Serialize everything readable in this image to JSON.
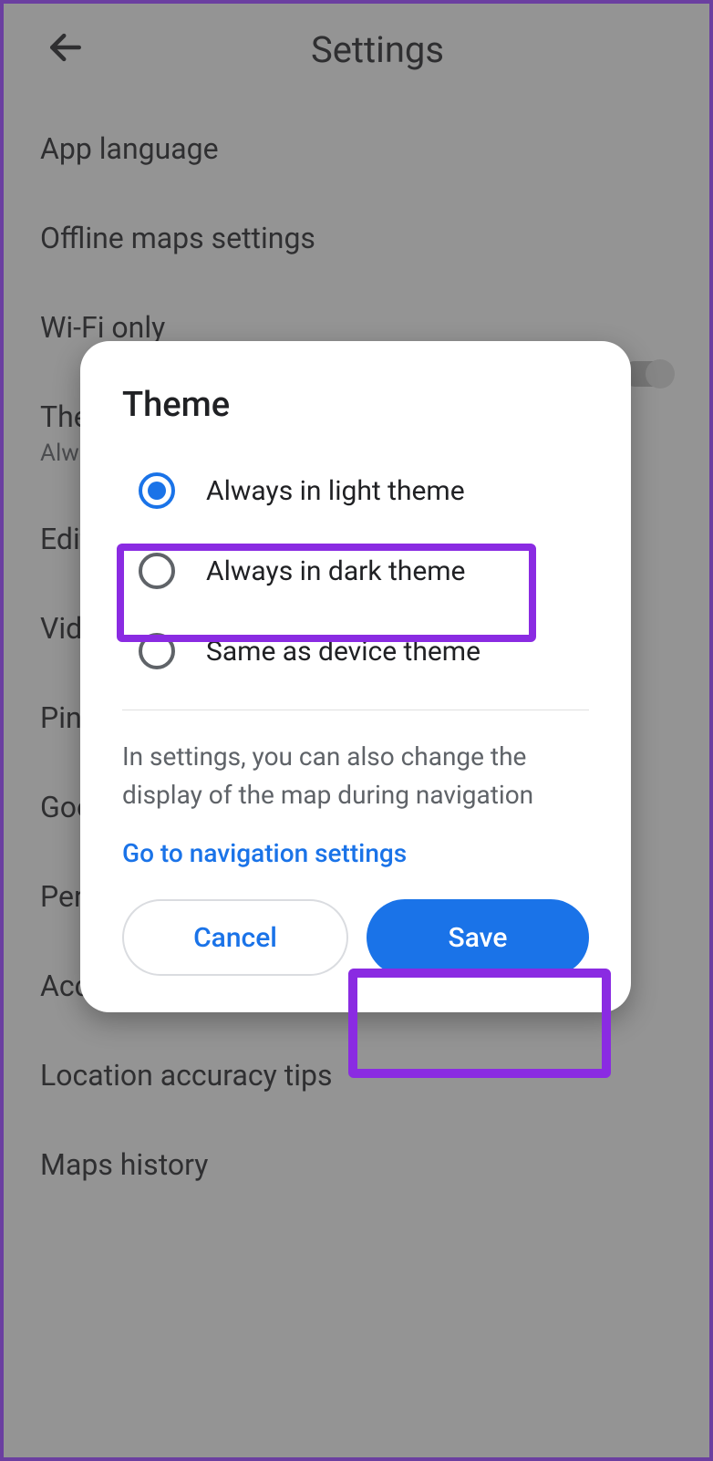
{
  "header": {
    "title": "Settings"
  },
  "settings": {
    "items": [
      {
        "label": "App language"
      },
      {
        "label": "Offline maps settings"
      },
      {
        "label": "Wi-Fi only"
      },
      {
        "label": "Theme",
        "sub": "Always in light theme"
      },
      {
        "label": "Edit home or work"
      },
      {
        "label": "Video settings"
      },
      {
        "label": "Pinned trips"
      },
      {
        "label": "Google Assistant settings"
      },
      {
        "label": "Personal content"
      },
      {
        "label": "Accessibility settings"
      },
      {
        "label": "Location accuracy tips"
      },
      {
        "label": "Maps history"
      }
    ]
  },
  "dialog": {
    "title": "Theme",
    "options": [
      {
        "label": "Always in light theme",
        "selected": true
      },
      {
        "label": "Always in dark theme",
        "selected": false
      },
      {
        "label": "Same as device theme",
        "selected": false
      }
    ],
    "note": "In settings, you can also change the display of the map during navigation",
    "link": "Go to navigation settings",
    "cancel": "Cancel",
    "save": "Save"
  }
}
